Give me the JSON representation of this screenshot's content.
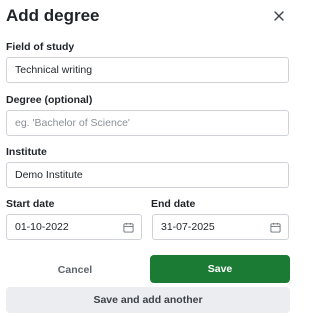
{
  "dialog": {
    "title": "Add degree",
    "close_icon": "close-icon"
  },
  "form": {
    "field_of_study": {
      "label": "Field of study",
      "value": "Technical writing"
    },
    "degree": {
      "label": "Degree (optional)",
      "placeholder": "eg. 'Bachelor of Science'"
    },
    "institute": {
      "label": "Institute",
      "value": "Demo Institute"
    },
    "start_date": {
      "label": "Start date",
      "value": "01-10-2022",
      "icon": "calendar-icon"
    },
    "end_date": {
      "label": "End date",
      "value": "31-07-2025",
      "icon": "calendar-icon"
    }
  },
  "actions": {
    "cancel": "Cancel",
    "save": "Save",
    "save_and_add": "Save and add another"
  },
  "colors": {
    "primary": "#1b7a33",
    "secondary_bg": "#ecedf1",
    "border": "#cfd3d8"
  }
}
